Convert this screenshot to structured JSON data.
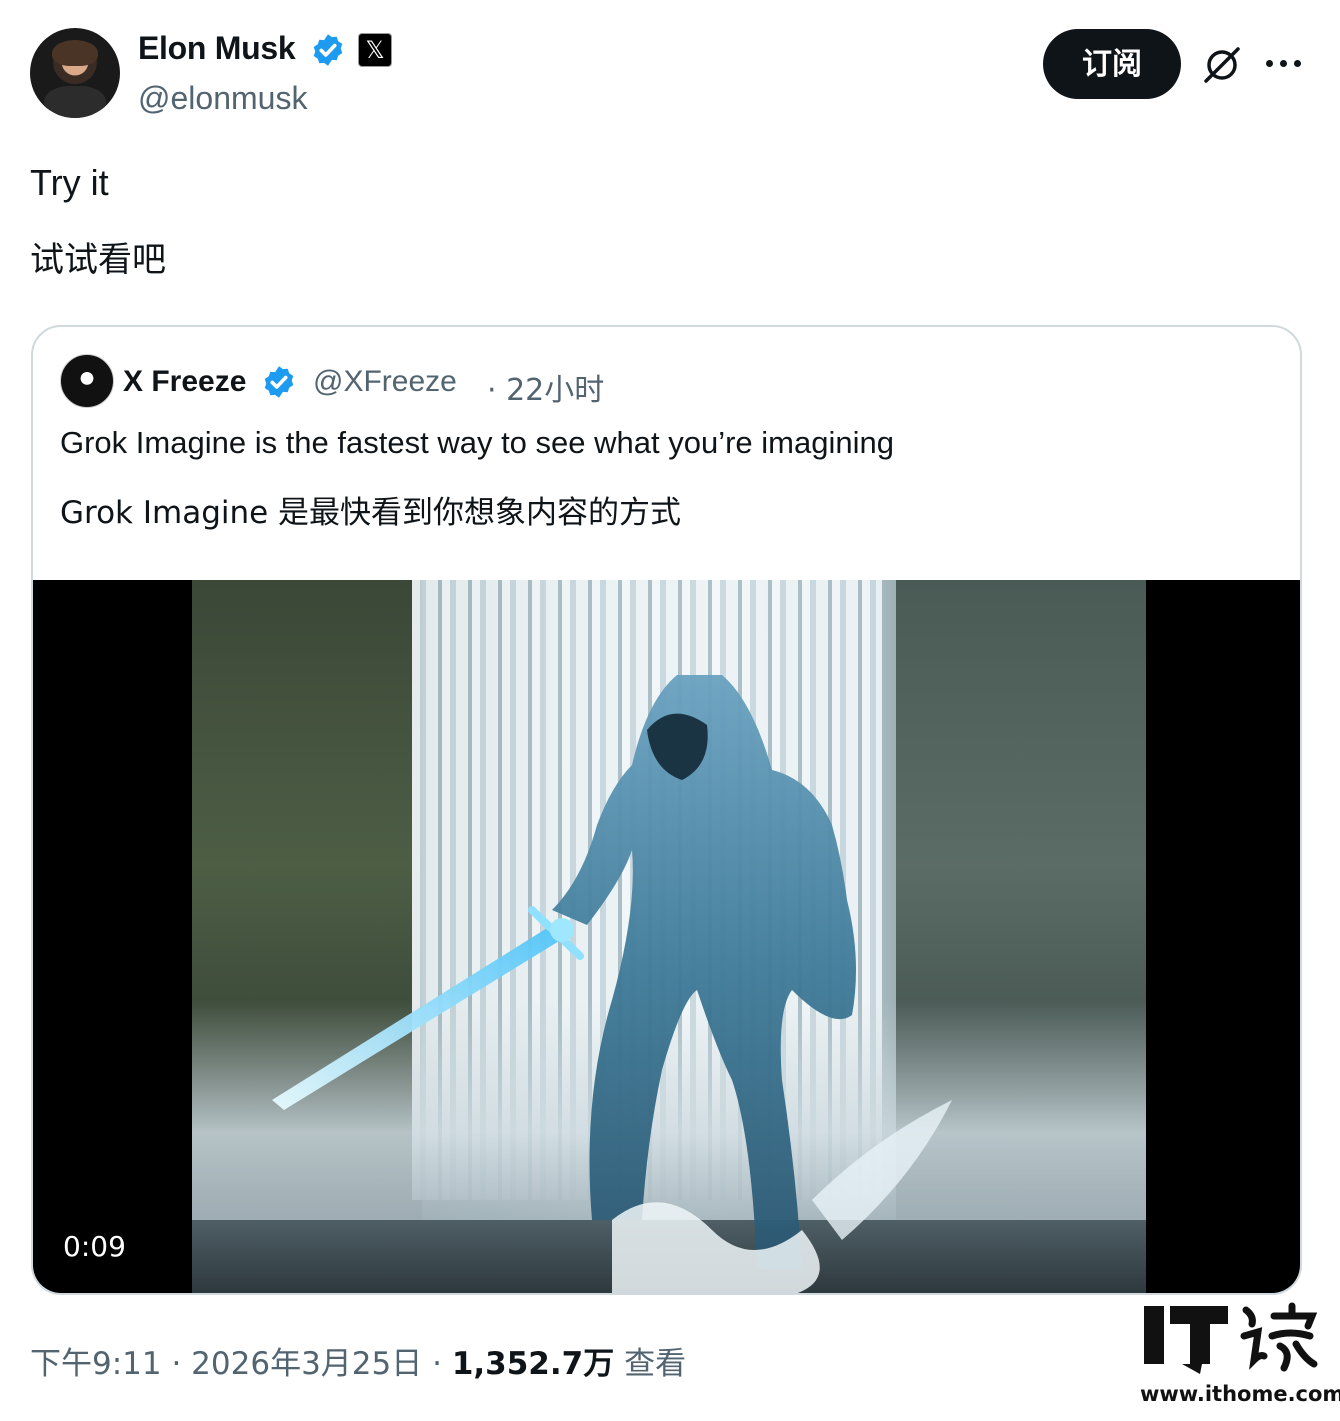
{
  "author": {
    "name": "Elon Musk",
    "handle": "@elonmusk",
    "badge_icon": "x-logo-icon",
    "verified_color": "#1d9bf0"
  },
  "actions": {
    "subscribe_label": "订阅",
    "grok_icon": "grok-icon",
    "more_icon": "more-icon"
  },
  "tweet": {
    "text": "Try it",
    "translation": "试试看吧"
  },
  "quote": {
    "name": "X Freeze",
    "handle": "@XFreeze",
    "time": "· 22小时",
    "text": "Grok Imagine is the fastest way to see what you’re imagining",
    "translation": "Grok Imagine 是最快看到你想象内容的方式",
    "video": {
      "timestamp": "0:09",
      "description_icon": "video-thumbnail"
    }
  },
  "meta": {
    "time": "下午9:11 · 2026年3月25日 · ",
    "views_count": "1,352.7万",
    "views_label": " 查看"
  },
  "watermark": {
    "logo": "IT之家",
    "url": "www.ithome.com"
  }
}
